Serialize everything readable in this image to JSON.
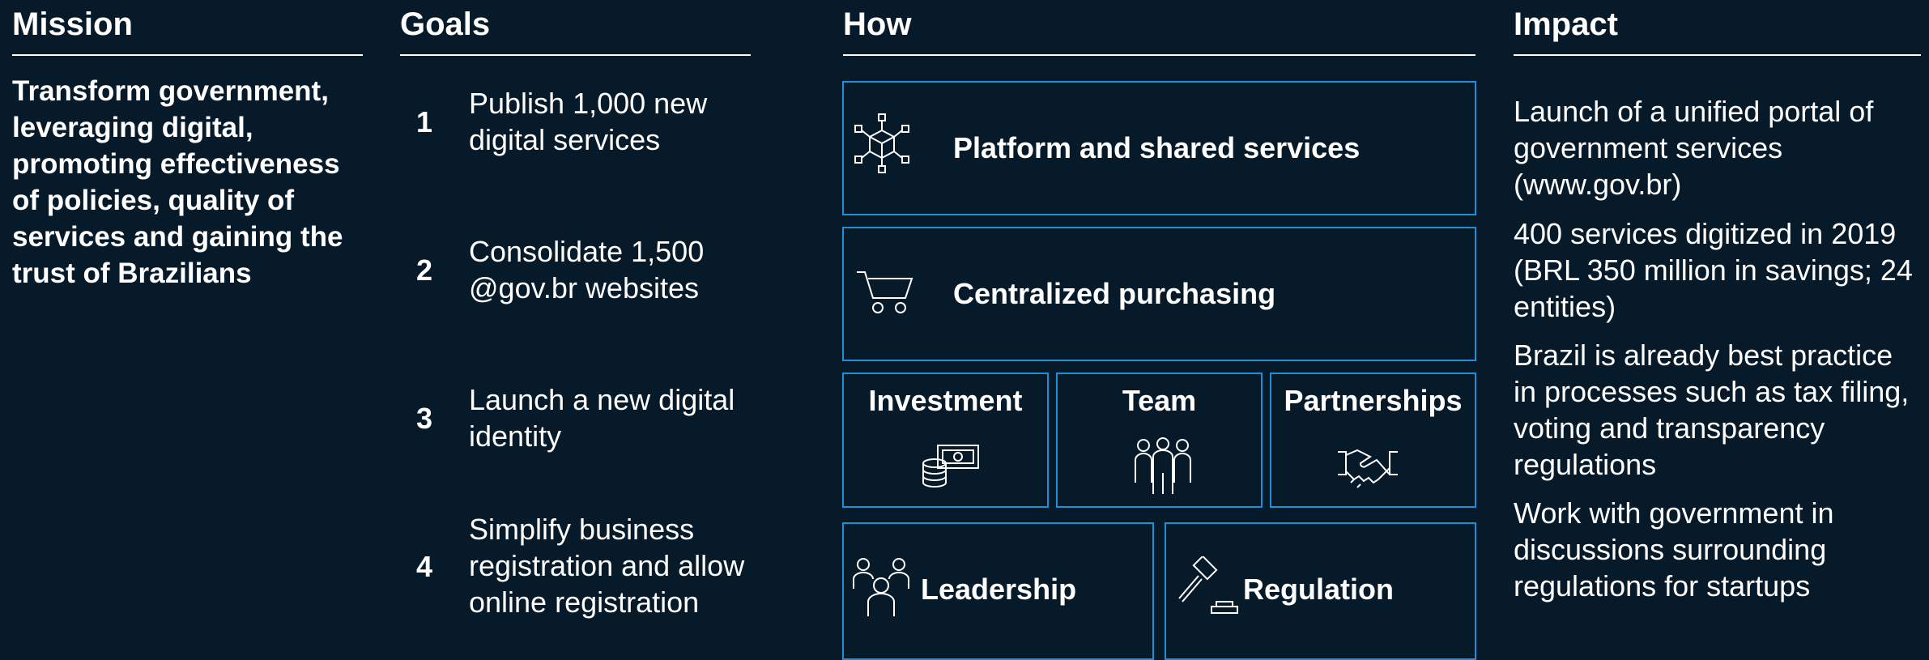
{
  "columns": {
    "mission": "Mission",
    "goals": "Goals",
    "how": "How",
    "impact": "Impact"
  },
  "mission": {
    "text": "Transform government, leveraging digital, promoting effectiveness of policies, quality of services and gaining the trust of Brazilians"
  },
  "goals": [
    {
      "number": "1",
      "text": "Publish 1,000 new digital services"
    },
    {
      "number": "2",
      "text": "Consolidate 1,500 @gov.br websites"
    },
    {
      "number": "3",
      "text": "Launch a new digital identity"
    },
    {
      "number": "4",
      "text": "Simplify business registration and allow online registration"
    }
  ],
  "how": {
    "platform": {
      "label": "Platform and shared services",
      "icon": "network-cube-icon"
    },
    "purchasing": {
      "label": "Centralized purchasing",
      "icon": "shopping-cart-icon"
    },
    "investment": {
      "label": "Investment",
      "icon": "money-coins-icon"
    },
    "team": {
      "label": "Team",
      "icon": "people-group-icon"
    },
    "partnerships": {
      "label": "Partnerships",
      "icon": "handshake-icon"
    },
    "leadership": {
      "label": "Leadership",
      "icon": "leader-people-icon"
    },
    "regulation": {
      "label": "Regulation",
      "icon": "gavel-icon"
    }
  },
  "impact": [
    "Launch of a unified portal of government services (www.gov.br)",
    "400 services digitized in 2019 (BRL 350 million in savings; 24 entities)",
    "Brazil is already best practice in processes such as tax filing, voting and transparency regulations",
    "Work with government in discussions surrounding regulations for startups"
  ],
  "colors": {
    "background": "#061a2a",
    "box_border": "#1f8fd6",
    "text": "#ffffff"
  }
}
